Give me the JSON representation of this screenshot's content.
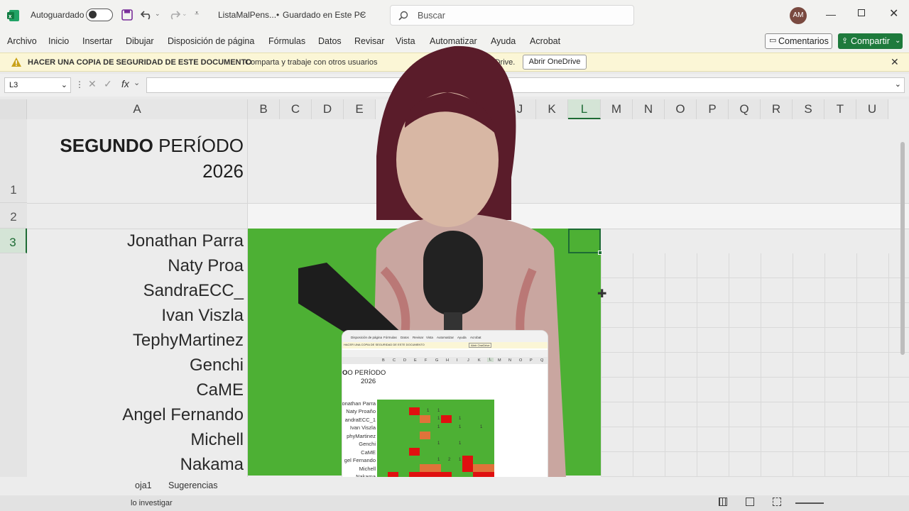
{
  "titlebar": {
    "autosave_label": "Autoguardado",
    "file_name": "ListaMalPens...",
    "save_status": "Guardado en Este PC",
    "search_placeholder": "Buscar",
    "user_initials": "AM"
  },
  "menu": {
    "items": [
      "Archivo",
      "Inicio",
      "Insertar",
      "Dibujar",
      "Disposición de página",
      "Fórmulas",
      "Datos",
      "Revisar",
      "Vista",
      "Automatizar",
      "Ayuda",
      "Acrobat"
    ],
    "comments": "Comentarios",
    "share": "Compartir"
  },
  "infobar": {
    "title": "HACER UNA COPIA DE SEGURIDAD DE ESTE DOCUMENTO",
    "message": "Comparta y trabaje con otros usuarios",
    "message_end": "con OneDrive.",
    "button": "Abrir OneDrive"
  },
  "formula": {
    "namebox": "L3",
    "fx": "fx",
    "value": ""
  },
  "grid": {
    "columns": [
      "A",
      "B",
      "C",
      "D",
      "E",
      "J",
      "K",
      "L",
      "M",
      "N",
      "O",
      "P",
      "Q",
      "R",
      "S",
      "T",
      "U"
    ],
    "rows": [
      "1",
      "2",
      "3"
    ],
    "title_bold": "SEGUNDO",
    "title_rest": " PERÍODO",
    "title_year": "2026",
    "names": [
      "Jonathan Parra",
      "Naty Proa",
      "SandraECC_",
      "Ivan Viszla",
      "TephyMartinez",
      "Genchi",
      "CaME",
      "Angel Fernando",
      "Michell",
      "Nakama"
    ]
  },
  "sheets": {
    "tabs": [
      "oja1",
      "Sugerencias"
    ]
  },
  "status": {
    "left": "lo investigar"
  },
  "mini": {
    "menu": [
      "Disposición de página",
      "Fórmulas",
      "Datos",
      "Revisar",
      "Vista",
      "Automatizar",
      "Ayuda",
      "Acrobat"
    ],
    "info": "HACER UNA COPIA DE SEGURIDAD DE ESTE DOCUMENTO",
    "info_button": "Abrir OneDrive",
    "columns": [
      "B",
      "C",
      "D",
      "E",
      "F",
      "G",
      "H",
      "I",
      "J",
      "K",
      "L",
      "M",
      "N",
      "O",
      "P",
      "Q"
    ],
    "title": "O PERÍODO",
    "year": "2026",
    "names": [
      "onathan Parra",
      "Naty Proaño",
      "andraECC_1",
      "Ivan Viszla",
      "phyMartinez",
      "Genchi",
      "CaME",
      "gel Fernando",
      "Michell",
      "Nakama"
    ],
    "ones": [
      "1",
      "1",
      "1",
      "1",
      "1",
      "1",
      "1",
      "1",
      "1",
      "1",
      "2",
      "1"
    ]
  },
  "colors": {
    "excel_green": "#1e7a3c",
    "cell_green": "#4db034",
    "mark_red": "#e01010",
    "mark_orange": "#e0733a"
  }
}
